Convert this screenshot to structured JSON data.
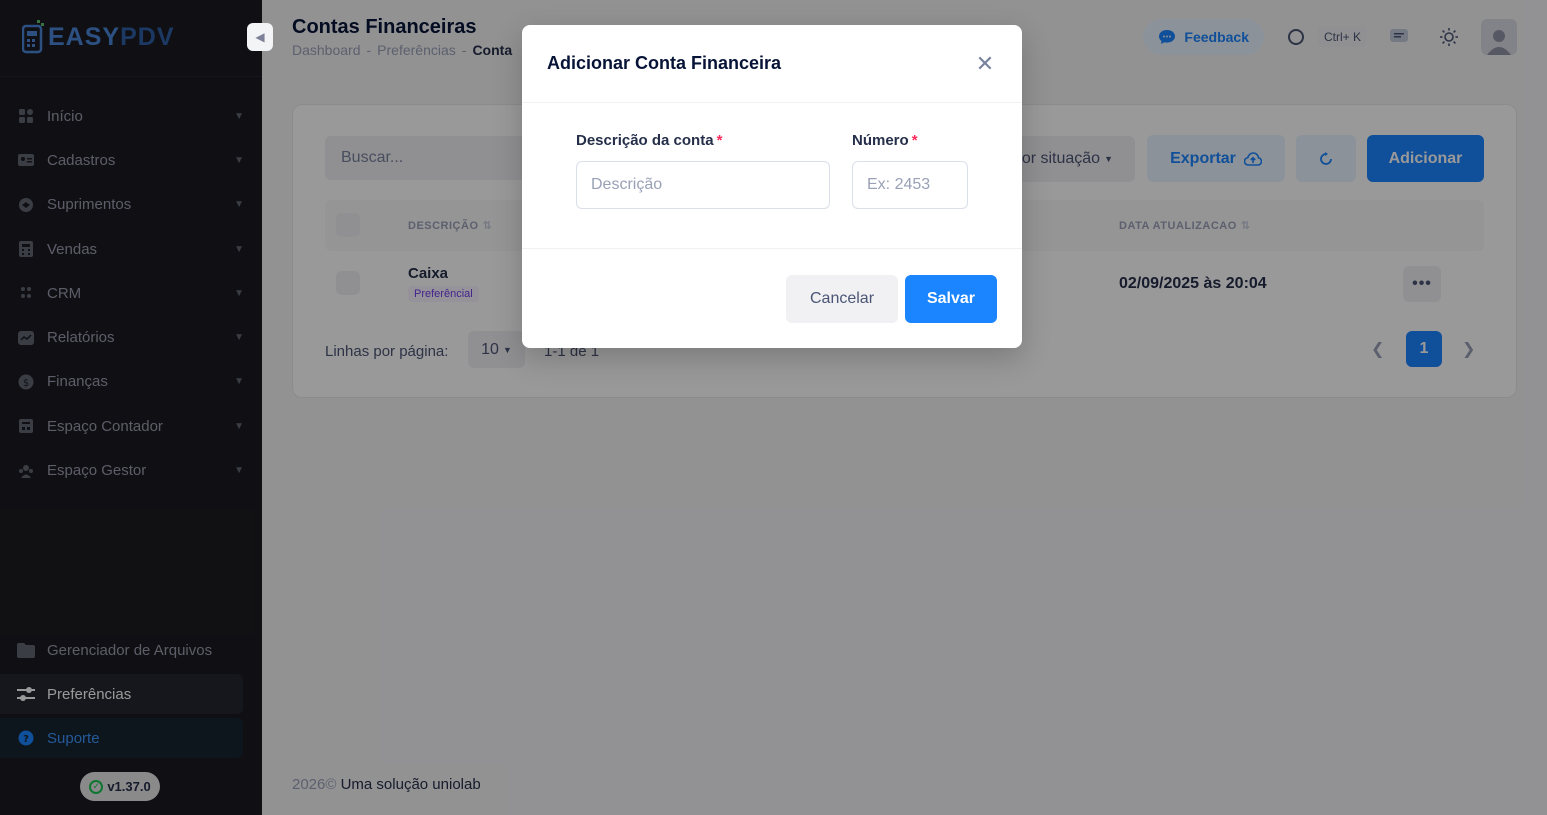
{
  "sidebar": {
    "logo": {
      "part1": "EASY",
      "part2": "PDV"
    },
    "collapse_icon": "chevron-left-icon",
    "items": [
      {
        "label": "Início",
        "icon": "grid-icon"
      },
      {
        "label": "Cadastros",
        "icon": "id-card-icon"
      },
      {
        "label": "Suprimentos",
        "icon": "box-icon"
      },
      {
        "label": "Vendas",
        "icon": "calculator-icon"
      },
      {
        "label": "CRM",
        "icon": "people-icon"
      },
      {
        "label": "Relatórios",
        "icon": "chart-icon"
      },
      {
        "label": "Finanças",
        "icon": "dollar-icon"
      },
      {
        "label": "Espaço Contador",
        "icon": "office-icon"
      },
      {
        "label": "Espaço Gestor",
        "icon": "team-icon"
      }
    ],
    "bottom": [
      {
        "label": "Gerenciador de Arquivos",
        "icon": "folder-icon"
      },
      {
        "label": "Preferências",
        "icon": "sliders-icon"
      },
      {
        "label": "Suporte",
        "icon": "question-icon"
      }
    ],
    "version": "v1.37.0"
  },
  "header": {
    "title": "Contas Financeiras",
    "breadcrumb": [
      "Dashboard",
      "Preferências",
      "Conta"
    ],
    "breadcrumb_sep": "-",
    "feedback_label": "Feedback",
    "shortcut": "Ctrl+ K"
  },
  "toolbar": {
    "search_placeholder": "Buscar...",
    "status_filter": "or situação",
    "export_label": "Exportar",
    "add_label": "Adicionar"
  },
  "table": {
    "columns": [
      "DESCRIÇÃO",
      "DATA ATUALIZACAO"
    ],
    "rows": [
      {
        "name": "Caixa",
        "badge": "Preferêncial",
        "updated": "02/09/2025 às 20:04"
      }
    ]
  },
  "pagination": {
    "rows_label": "Linhas por página:",
    "rows_value": "10",
    "range": "1-1 de 1",
    "current_page": "1"
  },
  "footer": {
    "year": "2026©",
    "brand": "Uma solução uniolab"
  },
  "modal": {
    "title": "Adicionar Conta Financeira",
    "desc_label": "Descrição da conta",
    "desc_placeholder": "Descrição",
    "number_label": "Número",
    "number_placeholder": "Ex: 2453",
    "required_mark": "*",
    "cancel_label": "Cancelar",
    "save_label": "Salvar"
  },
  "colors": {
    "primary": "#1b84ff",
    "sidebar_bg": "#1c1c22",
    "required": "#f8285a"
  }
}
